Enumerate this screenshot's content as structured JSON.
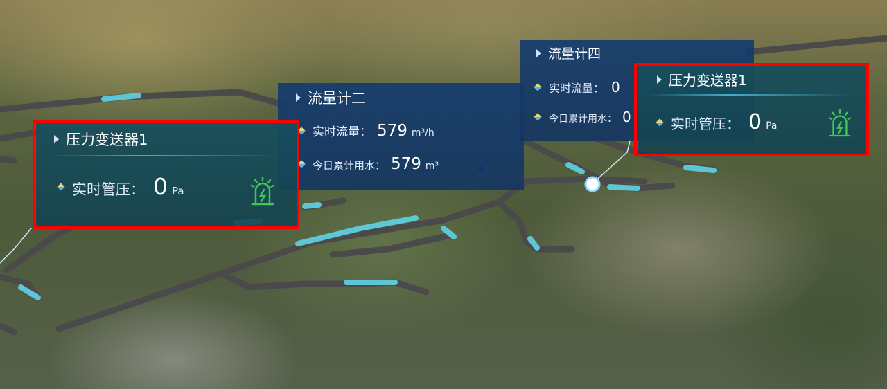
{
  "panels": {
    "flowmeter2": {
      "title": "流量计二",
      "rows": [
        {
          "label": "实时流量：",
          "value": "579",
          "unit": "m³/h"
        },
        {
          "label": "今日累计用水：",
          "value": "579",
          "unit": "m³"
        }
      ]
    },
    "flowmeter4": {
      "title": "流量计四",
      "rows": [
        {
          "label": "实时流量：",
          "value": "0"
        },
        {
          "label": "今日累计用水：",
          "value": "0"
        }
      ]
    },
    "pressure_left": {
      "title": "压力变送器1",
      "label": "实时管压：",
      "value": "0",
      "unit": "Pa",
      "status_icon": "alarm-light-icon"
    },
    "pressure_right": {
      "title": "压力变送器1",
      "label": "实时管压：",
      "value": "0",
      "unit": "Pa",
      "status_icon": "alarm-light-icon"
    }
  },
  "colors": {
    "highlight": "#ff0000",
    "pipe": "#5a5a5a",
    "pipe_active": "#5fd3e6",
    "alarm": "#3ec85a"
  }
}
